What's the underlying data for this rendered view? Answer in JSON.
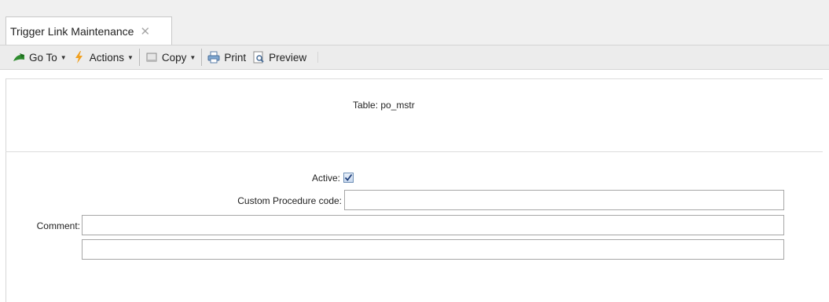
{
  "tab": {
    "label": "Trigger Link Maintenance",
    "close_glyph": "✕"
  },
  "toolbar": {
    "goto_label": "Go To",
    "actions_label": "Actions",
    "copy_label": "Copy",
    "print_label": "Print",
    "preview_label": "Preview"
  },
  "header": {
    "table_label": "Table:",
    "table_value": "po_mstr"
  },
  "form": {
    "active_label": "Active:",
    "active_checked": true,
    "custom_procedure_label": "Custom Procedure code:",
    "custom_procedure_value": "",
    "comment_label": "Comment:",
    "comment_line1": "",
    "comment_line2": ""
  },
  "colors": {
    "accent_green": "#2e8b2e",
    "actions_orange": "#f0a020",
    "checkbox_blue": "#6e8fb6"
  }
}
